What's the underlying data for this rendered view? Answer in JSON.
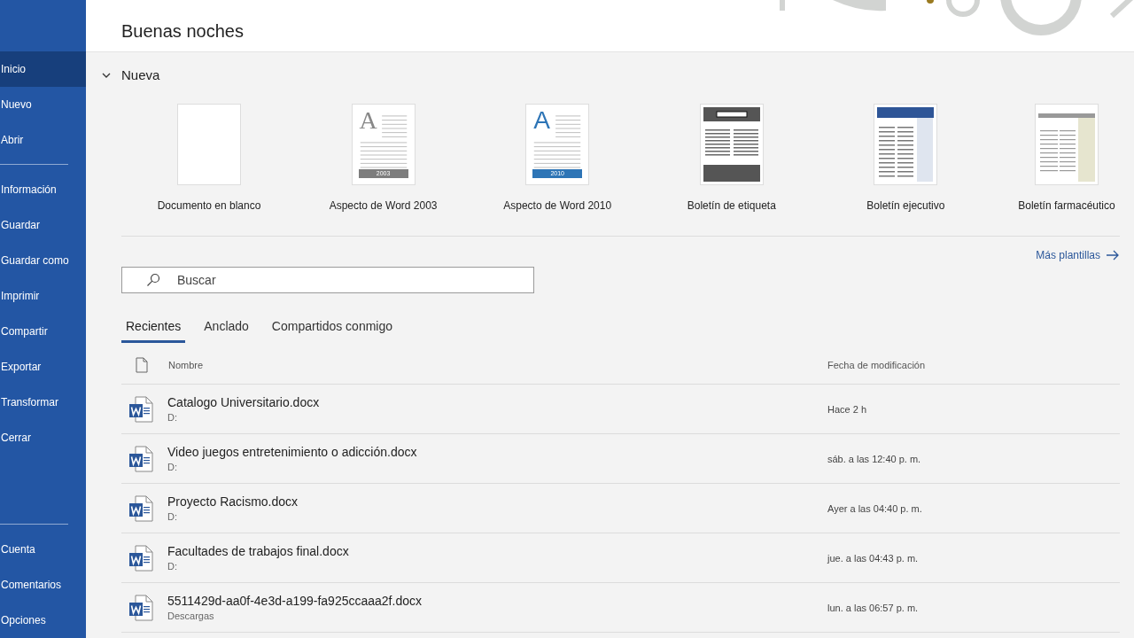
{
  "sidebar": {
    "groups": [
      [
        {
          "label": "Inicio",
          "selected": true
        },
        {
          "label": "Nuevo",
          "selected": false
        },
        {
          "label": "Abrir",
          "selected": false
        }
      ],
      [
        {
          "label": "Información",
          "selected": false
        },
        {
          "label": "Guardar",
          "selected": false
        },
        {
          "label": "Guardar como",
          "selected": false
        },
        {
          "label": "Imprimir",
          "selected": false
        },
        {
          "label": "Compartir",
          "selected": false
        },
        {
          "label": "Exportar",
          "selected": false
        },
        {
          "label": "Transformar",
          "selected": false
        },
        {
          "label": "Cerrar",
          "selected": false
        }
      ]
    ],
    "bottom": [
      {
        "label": "Cuenta",
        "selected": false
      },
      {
        "label": "Comentarios",
        "selected": false
      },
      {
        "label": "Opciones",
        "selected": false
      }
    ]
  },
  "greeting": "Buenas noches",
  "new_section": {
    "title": "Nueva",
    "expanded": true,
    "templates": [
      {
        "kind": "blank",
        "label": "Documento en blanco"
      },
      {
        "kind": "word2003",
        "label": "Aspecto de Word 2003",
        "glyph": "A",
        "badge": "2003"
      },
      {
        "kind": "word2010",
        "label": "Aspecto de Word 2010",
        "glyph": "A",
        "badge": "2010"
      },
      {
        "kind": "label",
        "label": "Boletín de etiqueta"
      },
      {
        "kind": "executive",
        "label": "Boletín ejecutivo"
      },
      {
        "kind": "pharma",
        "label": "Boletín farmacéutico"
      }
    ],
    "more": "Más plantillas"
  },
  "search": {
    "placeholder": "Buscar"
  },
  "tabs": [
    {
      "label": "Recientes",
      "selected": true
    },
    {
      "label": "Anclado",
      "selected": false
    },
    {
      "label": "Compartidos conmigo",
      "selected": false
    }
  ],
  "table": {
    "columns": [
      "Nombre",
      "Fecha de modificación"
    ],
    "rows": [
      {
        "name": "Catalogo Universitario.docx",
        "location": "D:",
        "modified": "Hace 2 h"
      },
      {
        "name": "Video juegos entretenimiento o adicción.docx",
        "location": "D:",
        "modified": "sáb. a las 12:40 p. m."
      },
      {
        "name": "Proyecto Racismo.docx",
        "location": "D:",
        "modified": "Ayer a las 04:40 p. m."
      },
      {
        "name": "Facultades de trabajos final.docx",
        "location": "D:",
        "modified": "jue. a las 04:43 p. m."
      },
      {
        "name": "5511429d-aa0f-4e3d-a199-fa925ccaaa2f.docx",
        "location": "Descargas",
        "modified": "lun. a las 06:57 p. m."
      }
    ]
  }
}
